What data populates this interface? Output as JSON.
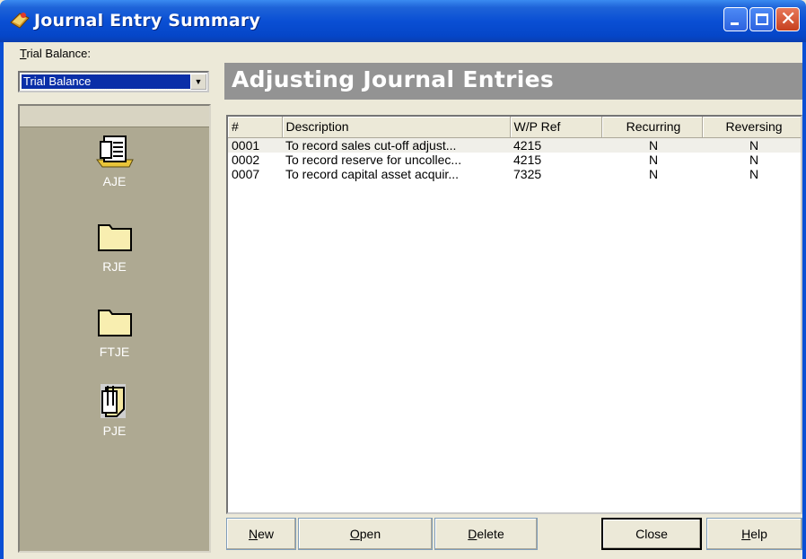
{
  "window": {
    "title": "Journal Entry Summary",
    "app_icon": "journal-app-icon",
    "controls": {
      "minimize": "minimize-icon",
      "maximize": "maximize-icon",
      "close": "close-icon"
    }
  },
  "trial_balance": {
    "label_accel": "T",
    "label_rest": "rial Balance:",
    "selected": "Trial Balance"
  },
  "categories": [
    {
      "label": "AJE",
      "icon": "aje-icon"
    },
    {
      "label": "RJE",
      "icon": "folder-icon"
    },
    {
      "label": "FTJE",
      "icon": "folder-icon"
    },
    {
      "label": "PJE",
      "icon": "pje-icon"
    }
  ],
  "heading": "Adjusting Journal Entries",
  "table": {
    "columns": [
      "#",
      "Description",
      "W/P Ref",
      "Recurring",
      "Reversing"
    ],
    "rows": [
      {
        "num": "0001",
        "description": "To record sales cut-off adjust...",
        "wp_ref": "4215",
        "recurring": "N",
        "reversing": "N"
      },
      {
        "num": "0002",
        "description": "To record reserve for uncollec...",
        "wp_ref": "4215",
        "recurring": "N",
        "reversing": "N"
      },
      {
        "num": "0007",
        "description": "To record capital asset acquir...",
        "wp_ref": "7325",
        "recurring": "N",
        "reversing": "N"
      }
    ]
  },
  "buttons": {
    "new": {
      "accel": "N",
      "rest": "ew"
    },
    "open": {
      "accel": "O",
      "rest": "pen"
    },
    "delete": {
      "accel": "D",
      "rest": "elete"
    },
    "close": {
      "label": "Close"
    },
    "help": {
      "accel": "H",
      "rest": "elp"
    }
  },
  "colors": {
    "titlebar": "#0a4fd4",
    "left_panel": "#aea992",
    "heading_bar": "#939393"
  }
}
